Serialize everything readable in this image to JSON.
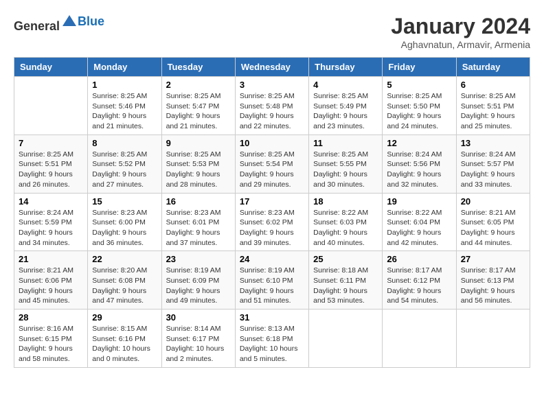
{
  "header": {
    "logo": {
      "text_general": "General",
      "text_blue": "Blue"
    },
    "title": "January 2024",
    "subtitle": "Aghavnatun, Armavir, Armenia"
  },
  "calendar": {
    "days_of_week": [
      "Sunday",
      "Monday",
      "Tuesday",
      "Wednesday",
      "Thursday",
      "Friday",
      "Saturday"
    ],
    "weeks": [
      [
        {
          "day": "",
          "info": ""
        },
        {
          "day": "1",
          "info": "Sunrise: 8:25 AM\nSunset: 5:46 PM\nDaylight: 9 hours\nand 21 minutes."
        },
        {
          "day": "2",
          "info": "Sunrise: 8:25 AM\nSunset: 5:47 PM\nDaylight: 9 hours\nand 21 minutes."
        },
        {
          "day": "3",
          "info": "Sunrise: 8:25 AM\nSunset: 5:48 PM\nDaylight: 9 hours\nand 22 minutes."
        },
        {
          "day": "4",
          "info": "Sunrise: 8:25 AM\nSunset: 5:49 PM\nDaylight: 9 hours\nand 23 minutes."
        },
        {
          "day": "5",
          "info": "Sunrise: 8:25 AM\nSunset: 5:50 PM\nDaylight: 9 hours\nand 24 minutes."
        },
        {
          "day": "6",
          "info": "Sunrise: 8:25 AM\nSunset: 5:51 PM\nDaylight: 9 hours\nand 25 minutes."
        }
      ],
      [
        {
          "day": "7",
          "info": "Sunrise: 8:25 AM\nSunset: 5:51 PM\nDaylight: 9 hours\nand 26 minutes."
        },
        {
          "day": "8",
          "info": "Sunrise: 8:25 AM\nSunset: 5:52 PM\nDaylight: 9 hours\nand 27 minutes."
        },
        {
          "day": "9",
          "info": "Sunrise: 8:25 AM\nSunset: 5:53 PM\nDaylight: 9 hours\nand 28 minutes."
        },
        {
          "day": "10",
          "info": "Sunrise: 8:25 AM\nSunset: 5:54 PM\nDaylight: 9 hours\nand 29 minutes."
        },
        {
          "day": "11",
          "info": "Sunrise: 8:25 AM\nSunset: 5:55 PM\nDaylight: 9 hours\nand 30 minutes."
        },
        {
          "day": "12",
          "info": "Sunrise: 8:24 AM\nSunset: 5:56 PM\nDaylight: 9 hours\nand 32 minutes."
        },
        {
          "day": "13",
          "info": "Sunrise: 8:24 AM\nSunset: 5:57 PM\nDaylight: 9 hours\nand 33 minutes."
        }
      ],
      [
        {
          "day": "14",
          "info": "Sunrise: 8:24 AM\nSunset: 5:59 PM\nDaylight: 9 hours\nand 34 minutes."
        },
        {
          "day": "15",
          "info": "Sunrise: 8:23 AM\nSunset: 6:00 PM\nDaylight: 9 hours\nand 36 minutes."
        },
        {
          "day": "16",
          "info": "Sunrise: 8:23 AM\nSunset: 6:01 PM\nDaylight: 9 hours\nand 37 minutes."
        },
        {
          "day": "17",
          "info": "Sunrise: 8:23 AM\nSunset: 6:02 PM\nDaylight: 9 hours\nand 39 minutes."
        },
        {
          "day": "18",
          "info": "Sunrise: 8:22 AM\nSunset: 6:03 PM\nDaylight: 9 hours\nand 40 minutes."
        },
        {
          "day": "19",
          "info": "Sunrise: 8:22 AM\nSunset: 6:04 PM\nDaylight: 9 hours\nand 42 minutes."
        },
        {
          "day": "20",
          "info": "Sunrise: 8:21 AM\nSunset: 6:05 PM\nDaylight: 9 hours\nand 44 minutes."
        }
      ],
      [
        {
          "day": "21",
          "info": "Sunrise: 8:21 AM\nSunset: 6:06 PM\nDaylight: 9 hours\nand 45 minutes."
        },
        {
          "day": "22",
          "info": "Sunrise: 8:20 AM\nSunset: 6:08 PM\nDaylight: 9 hours\nand 47 minutes."
        },
        {
          "day": "23",
          "info": "Sunrise: 8:19 AM\nSunset: 6:09 PM\nDaylight: 9 hours\nand 49 minutes."
        },
        {
          "day": "24",
          "info": "Sunrise: 8:19 AM\nSunset: 6:10 PM\nDaylight: 9 hours\nand 51 minutes."
        },
        {
          "day": "25",
          "info": "Sunrise: 8:18 AM\nSunset: 6:11 PM\nDaylight: 9 hours\nand 53 minutes."
        },
        {
          "day": "26",
          "info": "Sunrise: 8:17 AM\nSunset: 6:12 PM\nDaylight: 9 hours\nand 54 minutes."
        },
        {
          "day": "27",
          "info": "Sunrise: 8:17 AM\nSunset: 6:13 PM\nDaylight: 9 hours\nand 56 minutes."
        }
      ],
      [
        {
          "day": "28",
          "info": "Sunrise: 8:16 AM\nSunset: 6:15 PM\nDaylight: 9 hours\nand 58 minutes."
        },
        {
          "day": "29",
          "info": "Sunrise: 8:15 AM\nSunset: 6:16 PM\nDaylight: 10 hours\nand 0 minutes."
        },
        {
          "day": "30",
          "info": "Sunrise: 8:14 AM\nSunset: 6:17 PM\nDaylight: 10 hours\nand 2 minutes."
        },
        {
          "day": "31",
          "info": "Sunrise: 8:13 AM\nSunset: 6:18 PM\nDaylight: 10 hours\nand 5 minutes."
        },
        {
          "day": "",
          "info": ""
        },
        {
          "day": "",
          "info": ""
        },
        {
          "day": "",
          "info": ""
        }
      ]
    ]
  }
}
